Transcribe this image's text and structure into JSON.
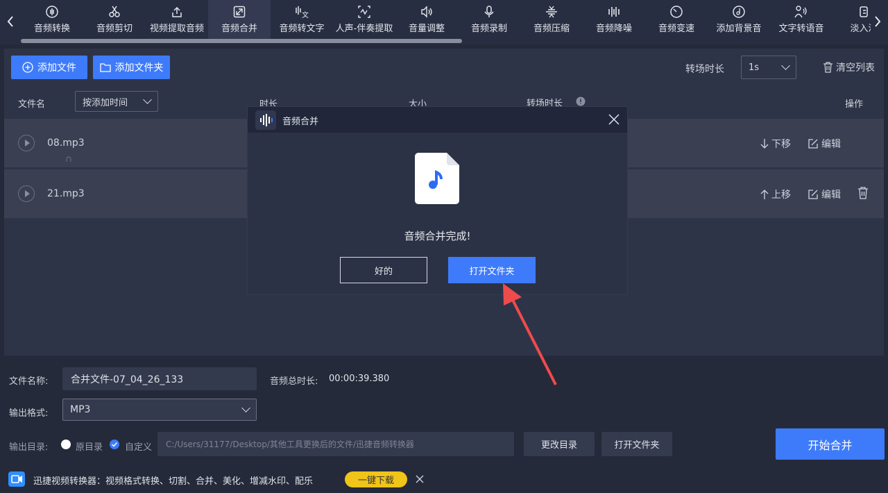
{
  "toolbar": {
    "tools": [
      {
        "label": "音频转换",
        "icon": "audio-convert-icon"
      },
      {
        "label": "音频剪切",
        "icon": "scissors-icon"
      },
      {
        "label": "视频提取音频",
        "icon": "upload-icon"
      },
      {
        "label": "音频合并",
        "icon": "merge-icon"
      },
      {
        "label": "音频转文字",
        "icon": "speech-to-text-icon"
      },
      {
        "label": "人声-伴奏提取",
        "icon": "waveform-icon"
      },
      {
        "label": "音量调整",
        "icon": "volume-icon"
      },
      {
        "label": "音频录制",
        "icon": "microphone-icon"
      },
      {
        "label": "音频压缩",
        "icon": "compress-icon"
      },
      {
        "label": "音频降噪",
        "icon": "denoise-icon"
      },
      {
        "label": "音频变速",
        "icon": "speed-icon"
      },
      {
        "label": "添加背景音",
        "icon": "background-music-icon"
      },
      {
        "label": "文字转语音",
        "icon": "text-to-speech-icon"
      },
      {
        "label": "淡入淡",
        "icon": "fade-icon"
      }
    ],
    "active_index": 3
  },
  "actions": {
    "add_file": "添加文件",
    "add_folder": "添加文件夹",
    "transition_label": "转场时长",
    "transition_value": "1s",
    "clear_list": "清空列表"
  },
  "table": {
    "col_name": "文件名",
    "sort_value": "按添加时间",
    "col_duration": "时长",
    "col_size": "大小",
    "col_transition": "转场时长",
    "col_action": "操作",
    "rows": [
      {
        "name": "08.mp3",
        "move": "下移",
        "edit": "编辑"
      },
      {
        "name": "21.mp3",
        "move": "上移",
        "edit": "编辑"
      }
    ]
  },
  "output": {
    "filename_label": "文件名称:",
    "filename_value": "合并文件-07_04_26_133",
    "total_duration_label": "音频总时长:",
    "total_duration_value": "00:00:39.380",
    "format_label": "输出格式:",
    "format_value": "MP3",
    "dir_label": "输出目录:",
    "radio_original": "原目录",
    "radio_custom": "自定义",
    "dir_path": "C:/Users/31177/Desktop/其他工具更换后的文件/迅捷音频转换器",
    "change_dir": "更改目录",
    "open_folder": "打开文件夹",
    "start": "开始合并"
  },
  "ad": {
    "text": "迅捷视频转换器：视频格式转换、切割、合并、美化、增减水印、配乐",
    "button": "一键下载"
  },
  "modal": {
    "title": "音频合并",
    "message": "音频合并完成!",
    "ok": "好的",
    "open_folder": "打开文件夹"
  },
  "colors": {
    "accent": "#3e7bfa",
    "annotation_arrow": "#f04b4b",
    "ad_button": "#f0c419"
  }
}
